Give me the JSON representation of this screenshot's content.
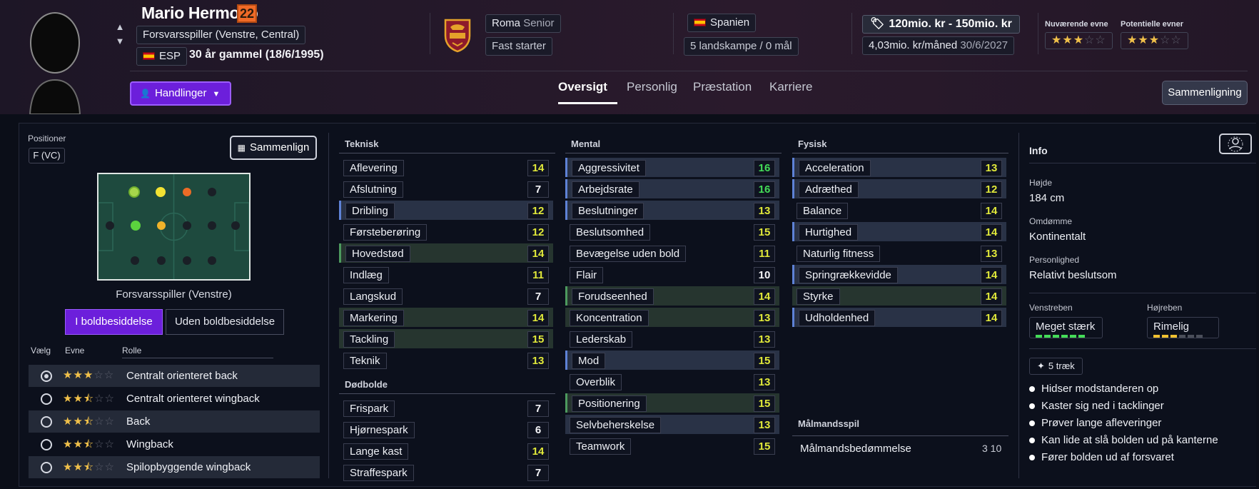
{
  "player": {
    "name": "Mario Hermoso",
    "number": "22",
    "position": "Forsvarsspiller (Venstre, Central)",
    "nation_code": "ESP",
    "age": "30 år gammel (18/6/1995)"
  },
  "club": {
    "name": "Roma",
    "squad": "Senior",
    "role": "Fast starter"
  },
  "nation": {
    "name": "Spanien",
    "caps": "5 landskampe / 0 mål"
  },
  "contract": {
    "value": "120mio. kr - 150mio. kr",
    "wage": "4,03mio. kr/måned",
    "expiry": "30/6/2027"
  },
  "ability": {
    "current_label": "Nuværende evne",
    "potential_label": "Potentielle evner",
    "current_stars": 3,
    "potential_stars": 3
  },
  "actions_label": "Handlinger",
  "tabs": [
    "Oversigt",
    "Personlig",
    "Præstation",
    "Karriere"
  ],
  "compare_label": "Sammenligning",
  "positions": {
    "label": "Positioner",
    "value": "F (VC)",
    "compare_label": "Sammenlign",
    "pitch_label": "Forsvarsspiller (Venstre)"
  },
  "possession": {
    "in": "I boldbesiddelse",
    "out": "Uden boldbesiddelse"
  },
  "roles": {
    "headers": [
      "Vælg",
      "Evne",
      "Rolle"
    ],
    "items": [
      {
        "name": "Centralt orienteret back",
        "stars": 3,
        "selected": true
      },
      {
        "name": "Centralt orienteret wingback",
        "stars": 2.5
      },
      {
        "name": "Back",
        "stars": 2.5
      },
      {
        "name": "Wingback",
        "stars": 2.5
      },
      {
        "name": "Spilopbyggende wingback",
        "stars": 2.5
      }
    ]
  },
  "attributes": {
    "teknisk": {
      "title": "Teknisk",
      "items": [
        [
          "Aflevering",
          "14"
        ],
        [
          "Afslutning",
          "7"
        ],
        [
          "Dribling",
          "12"
        ],
        [
          "Førsteberøring",
          "12"
        ],
        [
          "Hovedstød",
          "14"
        ],
        [
          "Indlæg",
          "11"
        ],
        [
          "Langskud",
          "7"
        ],
        [
          "Markering",
          "14"
        ],
        [
          "Tackling",
          "15"
        ],
        [
          "Teknik",
          "13"
        ]
      ]
    },
    "dodbolde": {
      "title": "Dødbolde",
      "items": [
        [
          "Frispark",
          "7"
        ],
        [
          "Hjørnespark",
          "6"
        ],
        [
          "Lange kast",
          "14"
        ],
        [
          "Straffespark",
          "7"
        ]
      ]
    },
    "mental": {
      "title": "Mental",
      "items": [
        [
          "Aggressivitet",
          "16"
        ],
        [
          "Arbejdsrate",
          "16"
        ],
        [
          "Beslutninger",
          "13"
        ],
        [
          "Beslutsomhed",
          "15"
        ],
        [
          "Bevægelse uden bold",
          "11"
        ],
        [
          "Flair",
          "10"
        ],
        [
          "Forudseenhed",
          "14"
        ],
        [
          "Koncentration",
          "13"
        ],
        [
          "Lederskab",
          "13"
        ],
        [
          "Mod",
          "15"
        ],
        [
          "Overblik",
          "13"
        ],
        [
          "Positionering",
          "15"
        ],
        [
          "Selvbeherskelse",
          "13"
        ],
        [
          "Teamwork",
          "15"
        ]
      ]
    },
    "fysisk": {
      "title": "Fysisk",
      "items": [
        [
          "Acceleration",
          "13"
        ],
        [
          "Adræthed",
          "12"
        ],
        [
          "Balance",
          "14"
        ],
        [
          "Hurtighed",
          "14"
        ],
        [
          "Naturlig fitness",
          "13"
        ],
        [
          "Springrækkevidde",
          "14"
        ],
        [
          "Styrke",
          "14"
        ],
        [
          "Udholdenhed",
          "14"
        ]
      ]
    },
    "malmand": {
      "title": "Målmandsspil",
      "label": "Målmandsbedømmelse",
      "value": "3 10"
    }
  },
  "info": {
    "title": "Info",
    "height_label": "Højde",
    "height": "184 cm",
    "rep_label": "Omdømme",
    "rep": "Kontinentalt",
    "pers_label": "Personlighed",
    "pers": "Relativt beslutsom",
    "left_label": "Venstreben",
    "left": "Meget stærk",
    "left_level": 6,
    "right_label": "Højreben",
    "right": "Rimelig",
    "right_level": 3,
    "traits_label": "5 træk",
    "traits": [
      "Hidser modstanderen op",
      "Kaster sig ned i tacklinger",
      "Prøver lange afleveringer",
      "Kan lide at slå bolden ud på kanterne",
      "Fører bolden ud af forsvaret"
    ]
  },
  "colors": {
    "accent": "#6c1fdb",
    "attr_yellow": "#e1e93a",
    "attr_green": "#44dc58",
    "star": "#f0c04a"
  }
}
